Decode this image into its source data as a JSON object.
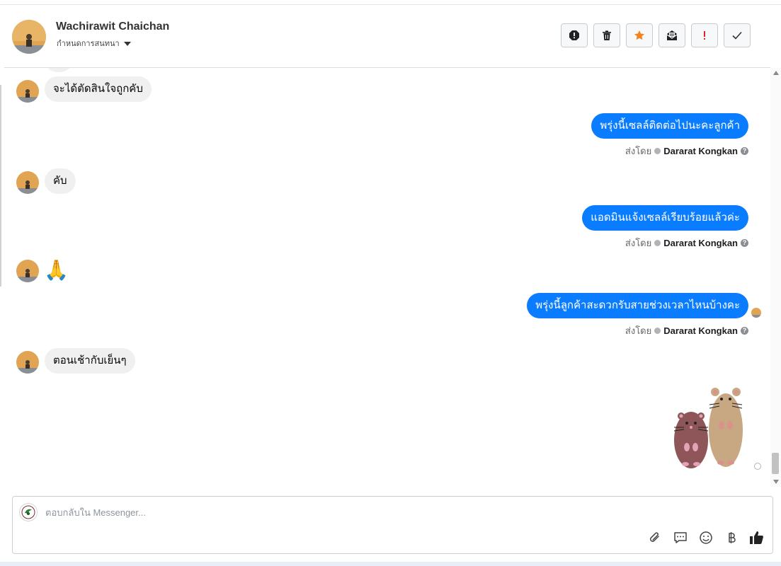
{
  "header": {
    "contact_name": "Wachirawit Chaichan",
    "subtitle": "กำหนดการสนทนา",
    "actions": [
      {
        "icon": "alert-circle-icon"
      },
      {
        "icon": "trash-icon"
      },
      {
        "icon": "star-icon",
        "color": "#f5821f"
      },
      {
        "icon": "mail-open-icon"
      },
      {
        "icon": "exclamation-icon",
        "color": "#e02424"
      },
      {
        "icon": "check-icon"
      }
    ]
  },
  "thread": {
    "messages": [
      {
        "from": "customer",
        "text": "จะได้ตัดสินใจถูกคับ"
      },
      {
        "from": "page",
        "text": "พรุ่งนี้เซลล์ติดต่อไปนะคะลูกค้า",
        "sent_by_label": "ส่งโดย",
        "sent_by_name": "Dararat Kongkan"
      },
      {
        "from": "customer",
        "text": "คับ"
      },
      {
        "from": "page",
        "text": "แอดมินแจ้งเซลล์เรียบร้อยแล้วค่ะ",
        "sent_by_label": "ส่งโดย",
        "sent_by_name": "Dararat Kongkan"
      },
      {
        "from": "customer",
        "text": "🙏"
      },
      {
        "from": "page",
        "text": "พรุ่งนี้ลูกค้าสะดวกรับสายช่วงเวลาไหนบ้างคะ",
        "sent_by_label": "ส่งโดย",
        "sent_by_name": "Dararat Kongkan"
      },
      {
        "from": "customer",
        "text": "ตอนเช้ากับเย็นๆ"
      },
      {
        "from": "page",
        "sticker": "two-hamsters-sticker"
      }
    ]
  },
  "composer": {
    "placeholder": "ตอบกลับใน Messenger...",
    "value": "",
    "tools": [
      "paperclip-icon",
      "saved-replies-icon",
      "emoji-icon",
      "baht-icon",
      "thumbs-up-icon"
    ]
  },
  "colors": {
    "outgoing_bubble": "#0a7cff",
    "incoming_bubble": "#f0f0f0",
    "accent_star": "#f5821f"
  }
}
